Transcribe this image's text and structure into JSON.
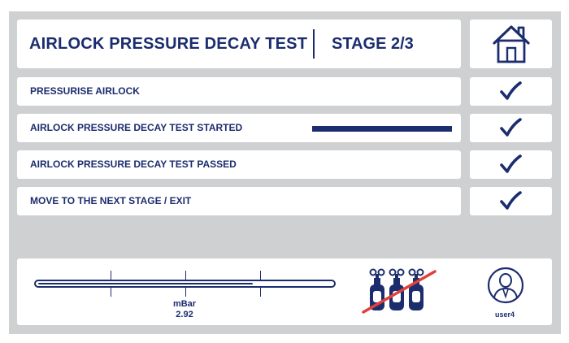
{
  "header": {
    "title": "AIRLOCK PRESSURE DECAY TEST",
    "stage": "STAGE 2/3",
    "home_icon": "home-icon"
  },
  "steps": [
    {
      "label": "PRESSURISE AIRLOCK",
      "status_icon": "check-icon",
      "completed": true
    },
    {
      "label": "AIRLOCK PRESSURE DECAY TEST STARTED",
      "status_icon": "check-icon",
      "completed": true
    },
    {
      "label": "AIRLOCK PRESSURE DECAY TEST PASSED",
      "status_icon": "check-icon",
      "completed": true
    },
    {
      "label": "MOVE TO THE NEXT STAGE / EXIT",
      "status_icon": "check-icon",
      "completed": true
    }
  ],
  "gauge": {
    "unit": "mBar",
    "value": "2.92",
    "fill_fraction": 0.73
  },
  "gas_status": {
    "icon": "gas-cylinders-crossed-icon"
  },
  "user": {
    "name": "user4",
    "icon": "user-avatar-icon"
  },
  "colors": {
    "navy": "#1c2d6e",
    "frame_gray": "#cfd0d2",
    "alert_red": "#e0413a"
  }
}
